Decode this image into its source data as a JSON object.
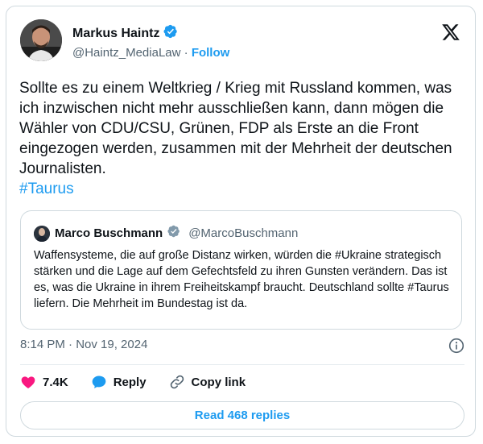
{
  "author": {
    "name": "Markus Haintz",
    "handle": "@Haintz_MediaLaw",
    "separator": " · ",
    "follow_label": "Follow"
  },
  "tweet": {
    "text": "Sollte es zu einem Weltkrieg / Krieg mit Russland kommen, was ich inzwischen nicht mehr ausschließen kann, dann mögen die Wähler von CDU/CSU, Grünen, FDP als Erste an die Front eingezogen werden, zusammen mit der Mehrheit der deutschen Journalisten.",
    "hashtag": "#Taurus"
  },
  "quote": {
    "name": "Marco Buschmann",
    "handle": "@MarcoBuschmann",
    "text": "Waffensysteme, die auf große Distanz wirken, würden die #Ukraine strategisch stärken und die Lage auf dem Gefechtsfeld zu ihren Gunsten verändern. Das ist es, was die Ukraine in ihrem Freiheitskampf braucht. Deutschland sollte #Taurus liefern. Die Mehrheit im Bundestag ist da."
  },
  "timestamp": "8:14 PM · Nov 19, 2024",
  "actions": {
    "like_count": "7.4K",
    "reply_label": "Reply",
    "copy_link_label": "Copy link"
  },
  "read_replies_label": "Read 468 replies",
  "colors": {
    "accent": "#1d9bf0",
    "like": "#f91880",
    "secondary_text": "#536471",
    "border": "#cfd9de"
  },
  "icons": [
    "verified-badge-icon",
    "x-logo-icon",
    "info-icon",
    "heart-icon",
    "reply-icon",
    "link-icon"
  ]
}
